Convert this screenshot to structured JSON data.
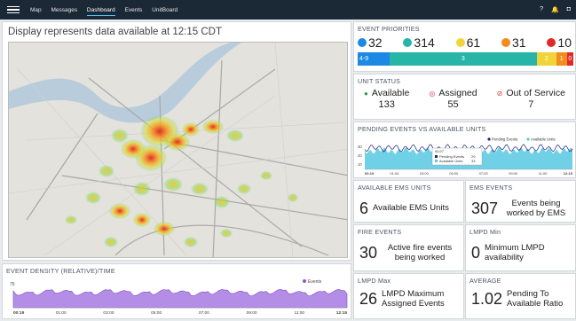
{
  "nav": {
    "items": [
      "Map",
      "Messages",
      "Dashboard",
      "Events",
      "UnitBoard"
    ],
    "active": "Dashboard",
    "icons": [
      "help-icon",
      "bell-icon",
      "user-icon"
    ]
  },
  "map": {
    "caption": "Display represents data available at 12:15 CDT"
  },
  "density": {
    "title": "EVENT DENSITY (RELATIVE)/TIME",
    "legend": "Events",
    "y_tick": "75",
    "x_ticks": [
      "00:19",
      "01:00",
      "03:00",
      "05:00",
      "07:00",
      "09:00",
      "11:00",
      "12:15"
    ]
  },
  "priorities": {
    "title": "EVENT PRIORITIES",
    "items": [
      {
        "value": "32",
        "color": "#1e88e5"
      },
      {
        "value": "314",
        "color": "#26b5a6"
      },
      {
        "value": "61",
        "color": "#f0d43a"
      },
      {
        "value": "31",
        "color": "#f28c1e"
      },
      {
        "value": "10",
        "color": "#e02a2a"
      }
    ],
    "bar": [
      {
        "label": "4-9",
        "share": 0.14,
        "color": "#1e88e5"
      },
      {
        "label": "3",
        "share": 0.69,
        "color": "#26b5a6"
      },
      {
        "label": "2",
        "share": 0.09,
        "color": "#f0d43a"
      },
      {
        "label": "1",
        "share": 0.05,
        "color": "#f28c1e"
      },
      {
        "label": "0",
        "share": 0.03,
        "color": "#e02a2a"
      }
    ]
  },
  "unit_status": {
    "title": "UNIT STATUS",
    "items": [
      {
        "label": "Available",
        "value": "133",
        "icon": "available-dot-icon",
        "color": "#2e9e3e"
      },
      {
        "label": "Assigned",
        "value": "55",
        "icon": "assigned-circle-icon",
        "color": "#d63384"
      },
      {
        "label": "Out of Service",
        "value": "7",
        "icon": "out-of-service-icon",
        "color": "#d63a3a"
      }
    ]
  },
  "pending": {
    "title": "PENDING EVENTS VS AVAILABLE UNITS",
    "legend": [
      "Pending Events",
      "Available Units"
    ],
    "y_ticks": [
      "30",
      "20",
      "10"
    ],
    "x_ticks": [
      "00:19",
      "01:00",
      "03:00",
      "05:00",
      "07:00",
      "09:00",
      "11:00",
      "12:15"
    ],
    "tooltip": {
      "time": "00:27",
      "pending_label": "Pending Events",
      "pending_value": "29",
      "available_label": "Available Units",
      "available_value": "33"
    }
  },
  "tiles": {
    "ems_units": {
      "title": "AVAILABLE EMS UNITS",
      "value": "6",
      "desc": "Available EMS Units"
    },
    "ems_events": {
      "title": "EMS EVENTS",
      "value": "307",
      "desc": "Events being worked by EMS"
    },
    "fire": {
      "title": "FIRE EVENTS",
      "value": "30",
      "desc": "Active fire events being worked"
    },
    "lmpd_min": {
      "title": "LMPD Min",
      "value": "0",
      "desc": "Minimum LMPD availability"
    },
    "lmpd_max": {
      "title": "LMPD Max",
      "value": "26",
      "desc": "LMPD Maximum Assigned Events"
    },
    "average": {
      "title": "AVERAGE",
      "value": "1.02",
      "desc": "Pending To Available Ratio"
    }
  }
}
